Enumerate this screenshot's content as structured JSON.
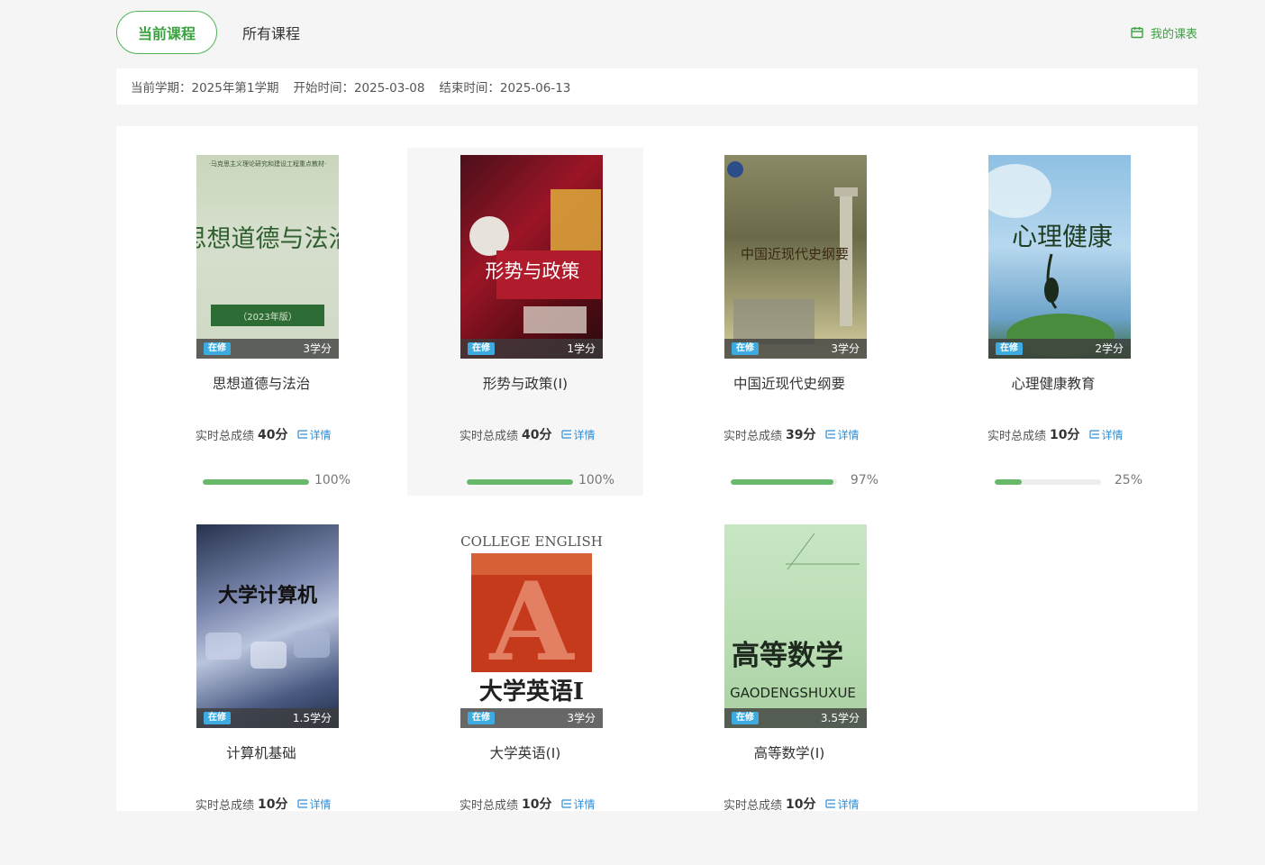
{
  "tabs": {
    "current": "当前课程",
    "all": "所有课程"
  },
  "schedule_link": "我的课表",
  "term": {
    "semester": "当前学期：2025年第1学期",
    "start": "开始时间：2025-03-08",
    "end": "结束时间：2025-06-13"
  },
  "status_label": "在修",
  "score_label": "实时总成绩",
  "detail_label": "详情",
  "cover_texts": {
    "c1_top": "·马克思主义理论研究和建设工程重点教材·",
    "c1_title": "思想道德与法治",
    "c1_edition": "（2023年版）",
    "c2_title": "形势与政策",
    "c3_title": "中国近现代史纲要",
    "c4_title": "心理健康",
    "c5_title": "大学计算机",
    "c6_top": "COLLEGE ENGLISH",
    "c6_letter": "A",
    "c6_title": "大学英语Ⅰ",
    "c7_title": "高等数学",
    "c7_sub": "GAODENGSHUXUE"
  },
  "courses": [
    {
      "name": "思想道德与法治",
      "credit": "3学分",
      "score": "40分",
      "progress": 100,
      "progress_text": "100%"
    },
    {
      "name": "形势与政策(Ⅰ)",
      "credit": "1学分",
      "score": "40分",
      "progress": 100,
      "progress_text": "100%"
    },
    {
      "name": "中国近现代史纲要",
      "credit": "3学分",
      "score": "39分",
      "progress": 97,
      "progress_text": "97%"
    },
    {
      "name": "心理健康教育",
      "credit": "2学分",
      "score": "10分",
      "progress": 25,
      "progress_text": "25%"
    },
    {
      "name": "计算机基础",
      "credit": "1.5学分",
      "score": "10分"
    },
    {
      "name": "大学英语(Ⅰ)",
      "credit": "3学分",
      "score": "10分"
    },
    {
      "name": "高等数学(Ⅰ)",
      "credit": "3.5学分",
      "score": "10分"
    }
  ],
  "colors": {
    "accent": "#3aa23f",
    "link": "#2e8fd8",
    "badge": "#3dabe0",
    "progress": "#67b86b"
  }
}
